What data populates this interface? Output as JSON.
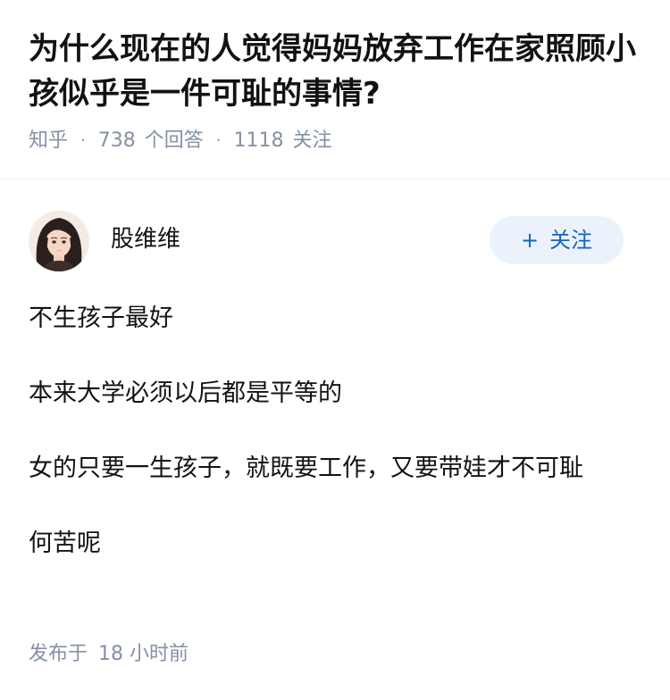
{
  "question": {
    "title": "为什么现在的人觉得妈妈放弃工作在家照顾小孩似乎是一件可耻的事情?",
    "source": "知乎",
    "separator": "·",
    "answer_count": "738",
    "answer_label": "个回答",
    "follower_count": "1118",
    "follower_label": "关注"
  },
  "author": {
    "name": "股维维",
    "avatar_icon": "avatar-woman-portrait",
    "follow_label": "关注",
    "follow_prefix": "+"
  },
  "answer": {
    "paragraphs": [
      "不生孩子最好",
      "本来大学必须以后都是平等的",
      "女的只要一生孩子，就既要工作，又要带娃才不可耻",
      "何苦呢"
    ]
  },
  "publish": {
    "label": "发布于",
    "time": "18 小时前"
  },
  "colors": {
    "text": "#121212",
    "meta": "#8590a6",
    "follow_bg": "#ebf2fb",
    "follow_text": "#1763c2",
    "divider": "#f0f0f2"
  }
}
